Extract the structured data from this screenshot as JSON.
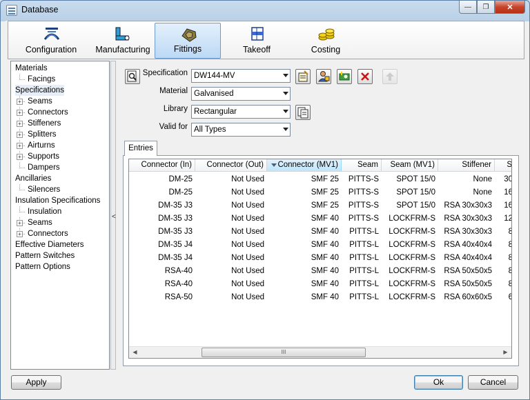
{
  "window": {
    "title": "Database",
    "minimize_label": "—",
    "maximize_label": "❐",
    "close_label": "✕"
  },
  "toolbar": {
    "tools": [
      {
        "label": "Configuration",
        "icon": "configuration-icon"
      },
      {
        "label": "Manufacturing",
        "icon": "manufacturing-icon"
      },
      {
        "label": "Fittings",
        "icon": "fittings-icon",
        "active": true
      },
      {
        "label": "Takeoff",
        "icon": "takeoff-icon"
      },
      {
        "label": "Costing",
        "icon": "costing-icon"
      }
    ]
  },
  "tree": {
    "nodes": [
      {
        "label": "Materials",
        "level": 0,
        "expandable": false
      },
      {
        "label": "Facings",
        "level": 1,
        "expandable": false
      },
      {
        "label": "Specifications",
        "level": 0,
        "expandable": false,
        "selected": true
      },
      {
        "label": "Seams",
        "level": 1,
        "expandable": true
      },
      {
        "label": "Connectors",
        "level": 1,
        "expandable": true
      },
      {
        "label": "Stiffeners",
        "level": 1,
        "expandable": true
      },
      {
        "label": "Splitters",
        "level": 1,
        "expandable": true
      },
      {
        "label": "Airturns",
        "level": 1,
        "expandable": true
      },
      {
        "label": "Supports",
        "level": 1,
        "expandable": true
      },
      {
        "label": "Dampers",
        "level": 1,
        "expandable": false
      },
      {
        "label": "Ancillaries",
        "level": 0,
        "expandable": false
      },
      {
        "label": "Silencers",
        "level": 1,
        "expandable": false
      },
      {
        "label": "Insulation Specifications",
        "level": 0,
        "expandable": false
      },
      {
        "label": "Insulation",
        "level": 1,
        "expandable": false
      },
      {
        "label": "Seams",
        "level": 1,
        "expandable": true
      },
      {
        "label": "Connectors",
        "level": 1,
        "expandable": true
      },
      {
        "label": "Effective Diameters",
        "level": 0,
        "expandable": false
      },
      {
        "label": "Pattern Switches",
        "level": 0,
        "expandable": false
      },
      {
        "label": "Pattern Options",
        "level": 0,
        "expandable": false
      }
    ],
    "expander_symbol": "+",
    "collapse_handle": "<"
  },
  "form": {
    "specification": {
      "label": "Specification",
      "value": "DW144-MV"
    },
    "material": {
      "label": "Material",
      "value": "Galvanised"
    },
    "library": {
      "label": "Library",
      "value": "Rectangular"
    },
    "valid_for": {
      "label": "Valid for",
      "value": "All Types"
    }
  },
  "tabs": {
    "entries_label": "Entries"
  },
  "grid": {
    "columns": [
      "Connector (In)",
      "Connector (Out)",
      "Connector (MV1)",
      "Seam",
      "Seam (MV1)",
      "Stiffener",
      "S"
    ],
    "rows": [
      [
        "DM-25",
        "Not Used",
        "SMF 25",
        "PITTS-S",
        "SPOT 15/0",
        "None",
        "30"
      ],
      [
        "DM-25",
        "Not Used",
        "SMF 25",
        "PITTS-S",
        "SPOT 15/0",
        "None",
        "16"
      ],
      [
        "DM-35 J3",
        "Not Used",
        "SMF 25",
        "PITTS-S",
        "SPOT 15/0",
        "RSA 30x30x3",
        "16"
      ],
      [
        "DM-35 J3",
        "Not Used",
        "SMF 40",
        "PITTS-S",
        "LOCKFRM-S",
        "RSA 30x30x3",
        "12"
      ],
      [
        "DM-35 J3",
        "Not Used",
        "SMF 40",
        "PITTS-L",
        "LOCKFRM-S",
        "RSA 30x30x3",
        "8"
      ],
      [
        "DM-35 J4",
        "Not Used",
        "SMF 40",
        "PITTS-L",
        "LOCKFRM-S",
        "RSA 40x40x4",
        "8"
      ],
      [
        "DM-35 J4",
        "Not Used",
        "SMF 40",
        "PITTS-L",
        "LOCKFRM-S",
        "RSA 40x40x4",
        "8"
      ],
      [
        "RSA-40",
        "Not Used",
        "SMF 40",
        "PITTS-L",
        "LOCKFRM-S",
        "RSA 50x50x5",
        "8"
      ],
      [
        "RSA-40",
        "Not Used",
        "SMF 40",
        "PITTS-L",
        "LOCKFRM-S",
        "RSA 50x50x5",
        "8"
      ],
      [
        "RSA-50",
        "Not Used",
        "SMF 40",
        "PITTS-L",
        "LOCKFRM-S",
        "RSA 60x60x5",
        "6"
      ]
    ],
    "scroll_left": "◀",
    "scroll_right": "▶",
    "scroll_grip": "III"
  },
  "buttons": {
    "apply": "Apply",
    "ok": "Ok",
    "cancel": "Cancel"
  }
}
